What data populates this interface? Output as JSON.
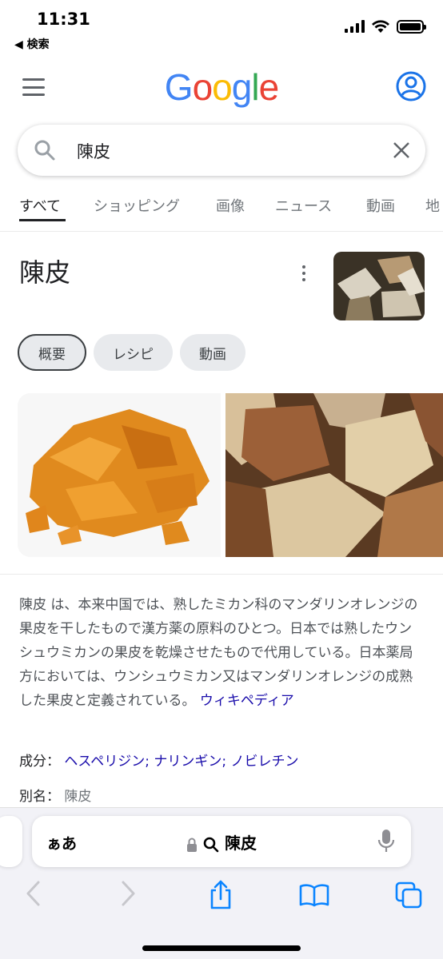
{
  "status_bar": {
    "time": "11:31",
    "back_label": "◀ 検索"
  },
  "header": {
    "logo_letters": [
      "G",
      "o",
      "o",
      "g",
      "l",
      "e"
    ],
    "logo_colors": [
      "#4285F4",
      "#EA4335",
      "#FBBC05",
      "#4285F4",
      "#34A853",
      "#EA4335"
    ]
  },
  "search": {
    "query": "陳皮"
  },
  "tabs": [
    "すべて",
    "ショッピング",
    "画像",
    "ニュース",
    "動画",
    "地"
  ],
  "panel": {
    "title": "陳皮",
    "chips": [
      "概要",
      "レシピ",
      "動画"
    ],
    "description": "陳皮 は、本来中国では、熟したミカン科のマンダリンオレンジの果皮を干したもので漢方薬の原料のひとつ。日本では熟したウンシュウミカンの果皮を乾燥させたもので代用している。日本薬局方においては、ウンシュウミカン又はマンダリンオレンジの成熟した果皮と定義されている。",
    "wiki_link": "ウィキペディア",
    "components_label": "成分：",
    "components_value": "ヘスペリジン; ナリンギン; ノビレチン",
    "alias_label": "別名：",
    "alias_value": "陳皮"
  },
  "safari": {
    "aa_label": "ぁあ",
    "url_text": "陳皮"
  },
  "colors": {
    "link": "#1a0dab",
    "accent_blue": "#4285F4",
    "safari_blue": "#0a84ff"
  }
}
